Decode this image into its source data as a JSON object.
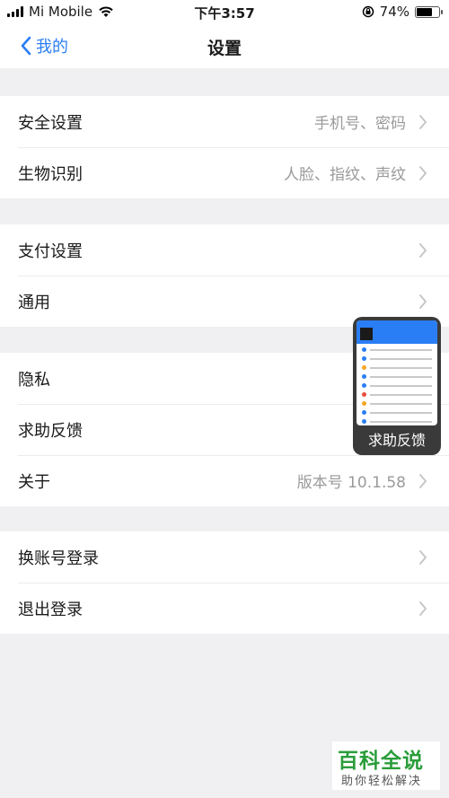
{
  "status_bar": {
    "carrier": "Mi Mobile",
    "time": "下午3:57",
    "battery": "74%",
    "battery_level": 0.74
  },
  "nav": {
    "back_label": "我的",
    "title": "设置"
  },
  "groups": [
    {
      "rows": [
        {
          "label": "安全设置",
          "value": "手机号、密码"
        },
        {
          "label": "生物识别",
          "value": "人脸、指纹、声纹"
        }
      ]
    },
    {
      "rows": [
        {
          "label": "支付设置",
          "value": ""
        },
        {
          "label": "通用",
          "value": ""
        }
      ]
    },
    {
      "rows": [
        {
          "label": "隐私",
          "value": ""
        },
        {
          "label": "求助反馈",
          "value": ""
        },
        {
          "label": "关于",
          "value": "版本号 10.1.58"
        }
      ]
    },
    {
      "rows": [
        {
          "label": "换账号登录",
          "value": ""
        },
        {
          "label": "退出登录",
          "value": ""
        }
      ]
    }
  ],
  "floating_window": {
    "label": "求助反馈"
  },
  "watermark": {
    "title": "百科全说",
    "subtitle": "助你轻松解决"
  }
}
